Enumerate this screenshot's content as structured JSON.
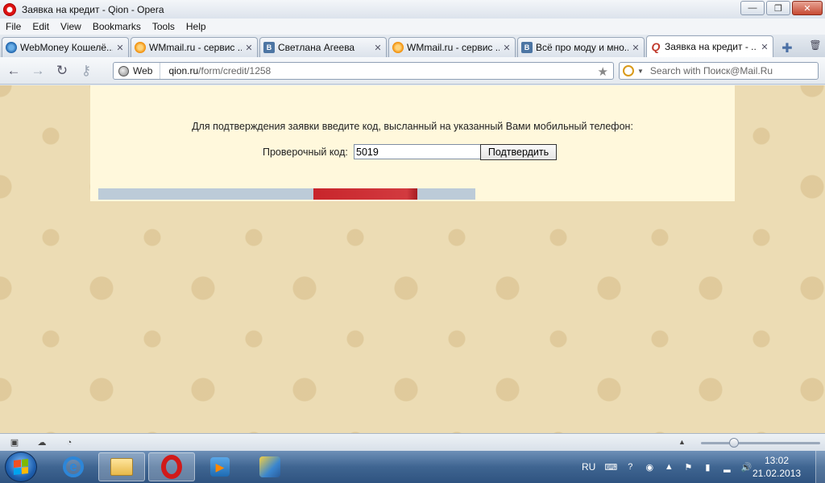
{
  "window": {
    "title": "Заявка на кредит - Qion - Opera"
  },
  "menu": [
    "File",
    "Edit",
    "View",
    "Bookmarks",
    "Tools",
    "Help"
  ],
  "tabs": [
    {
      "label": "WebMoney Кошелё...",
      "icon": "webmoney-icon",
      "active": false
    },
    {
      "label": "WMmail.ru - сервис ...",
      "icon": "wmmail-icon",
      "active": false
    },
    {
      "label": "Светлана Агеева",
      "icon": "vk-icon",
      "active": false
    },
    {
      "label": "WMmail.ru - сервис ...",
      "icon": "wmmail-icon",
      "active": false
    },
    {
      "label": "Всё про моду и мно...",
      "icon": "vk-icon",
      "active": false
    },
    {
      "label": "Заявка на кредит - ...",
      "icon": "qion-icon",
      "active": true
    }
  ],
  "address": {
    "web_label": "Web",
    "url_host": "qion.ru",
    "url_path": "/form/credit/1258"
  },
  "search": {
    "placeholder": "Search with Поиск@Mail.Ru"
  },
  "form": {
    "prompt": "Для подтверждения заявки введите код, высланный на указанный Вами мобильный телефон:",
    "code_label": "Проверочный код:",
    "code_value": "5019",
    "confirm_label": "Подтвердить"
  },
  "progress": {
    "start_pct": 57,
    "end_pct": 84.6
  },
  "zoom": {
    "level_pct": 28
  },
  "taskbar": {
    "lang": "RU",
    "time": "13:02",
    "date": "21.02.2013"
  },
  "colors": {
    "progress_fill": "#c8252b",
    "progress_track": "#bccbd8",
    "card_bg": "#fff8dc",
    "page_bg": "#ecdcb4"
  }
}
